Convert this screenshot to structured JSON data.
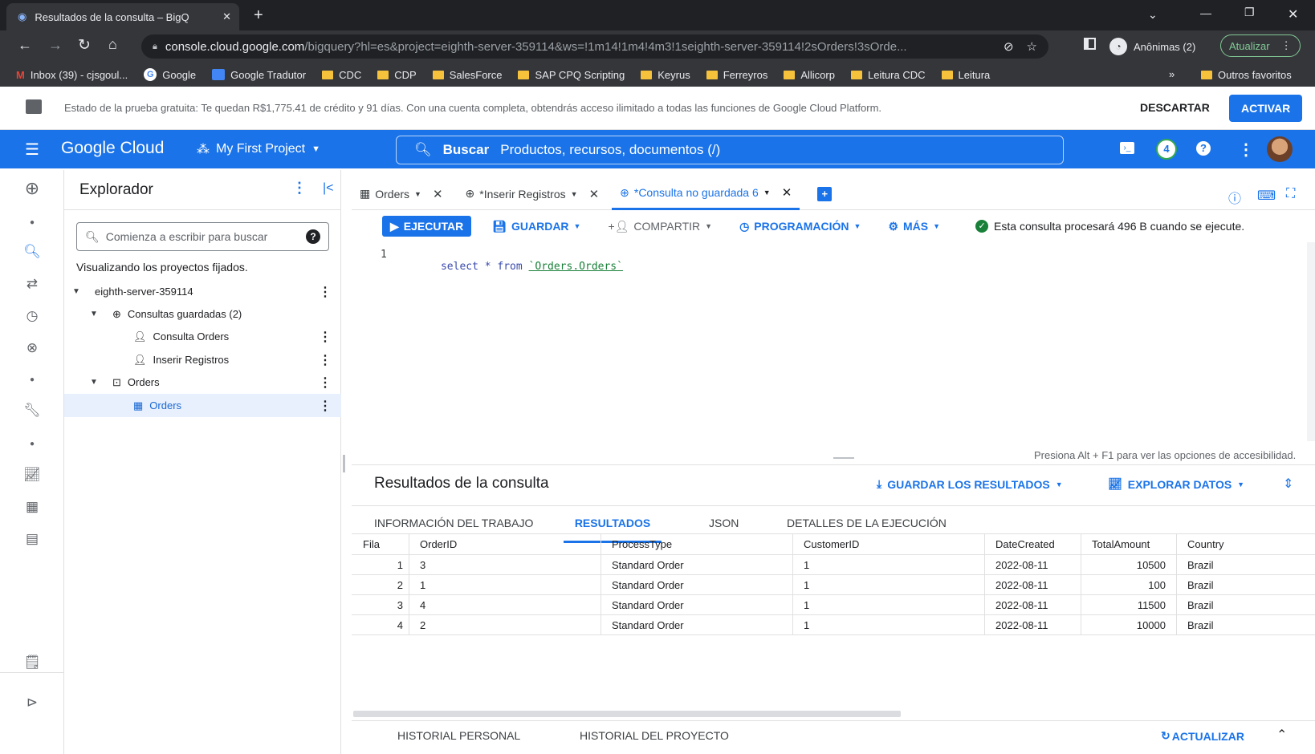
{
  "browser": {
    "tab_title": "Resultados de la consulta – BigQ",
    "url_host": "console.cloud.google.com",
    "url_path": "/bigquery?hl=es&project=eighth-server-359114&ws=!1m14!1m4!4m3!1seighth-server-359114!2sOrders!3sOrde...",
    "profile": "Anônimas (2)",
    "update_label": "Atualizar",
    "bookmarks": [
      "Inbox (39) - cjsgoul...",
      "Google",
      "Google Tradutor",
      "CDC",
      "CDP",
      "SalesForce",
      "SAP CPQ Scripting",
      "Keyrus",
      "Ferreyros",
      "Allicorp",
      "Leitura CDC",
      "Leitura"
    ],
    "bookmarks_more": "»",
    "other_favorites": "Outros favoritos"
  },
  "trial": {
    "text": "Estado de la prueba gratuita: Te quedan R$1,775.41 de crédito y 91 días. Con una cuenta completa, obtendrás acceso ilimitado a todas las funciones de Google Cloud Platform.",
    "dismiss": "DESCARTAR",
    "activate": "ACTIVAR"
  },
  "header": {
    "logo": "Google Cloud",
    "project": "My First Project",
    "search_label": "Buscar",
    "search_hint": "Productos, recursos, documentos (/)",
    "notif_count": "4"
  },
  "explorer": {
    "title": "Explorador",
    "search_placeholder": "Comienza a escribir para buscar",
    "pinned_note": "Visualizando los proyectos fijados.",
    "project": "eighth-server-359114",
    "saved_queries": "Consultas guardadas (2)",
    "query1": "Consulta Orders",
    "query2": "Inserir Registros",
    "dataset": "Orders",
    "table": "Orders"
  },
  "tabs": [
    {
      "label": "Orders"
    },
    {
      "label": "*Inserir Registros"
    },
    {
      "label": "*Consulta no guardada 6"
    }
  ],
  "editor_toolbar": {
    "run": "EJECUTAR",
    "save": "GUARDAR",
    "share": "COMPARTIR",
    "schedule": "PROGRAMACIÓN",
    "more": "MÁS",
    "status": "Esta consulta procesará 496 B cuando se ejecute."
  },
  "editor": {
    "line_no": "1",
    "code_kw": "select * from ",
    "code_table": "`Orders.Orders`",
    "a11y_hint": "Presiona Alt + F1 para ver las opciones de accesibilidad."
  },
  "results": {
    "title": "Resultados de la consulta",
    "save_results": "GUARDAR LOS RESULTADOS",
    "explore": "EXPLORAR DATOS",
    "tabs": [
      "INFORMACIÓN DEL TRABAJO",
      "RESULTADOS",
      "JSON",
      "DETALLES DE LA EJECUCIÓN"
    ],
    "columns": [
      "Fila",
      "OrderID",
      "ProcessType",
      "CustomerID",
      "DateCreated",
      "TotalAmount",
      "Country"
    ],
    "rows": [
      [
        "1",
        "3",
        "Standard Order",
        "1",
        "2022-08-11",
        "10500",
        "Brazil"
      ],
      [
        "2",
        "1",
        "Standard Order",
        "1",
        "2022-08-11",
        "100",
        "Brazil"
      ],
      [
        "3",
        "4",
        "Standard Order",
        "1",
        "2022-08-11",
        "11500",
        "Brazil"
      ],
      [
        "4",
        "2",
        "Standard Order",
        "1",
        "2022-08-11",
        "10000",
        "Brazil"
      ]
    ]
  },
  "footer": {
    "personal": "HISTORIAL PERSONAL",
    "project": "HISTORIAL DEL PROYECTO",
    "refresh": "ACTUALIZAR"
  },
  "colors": {
    "brand_blue": "#1a73e8",
    "run_button": "#1a73e8",
    "success": "#188038"
  }
}
